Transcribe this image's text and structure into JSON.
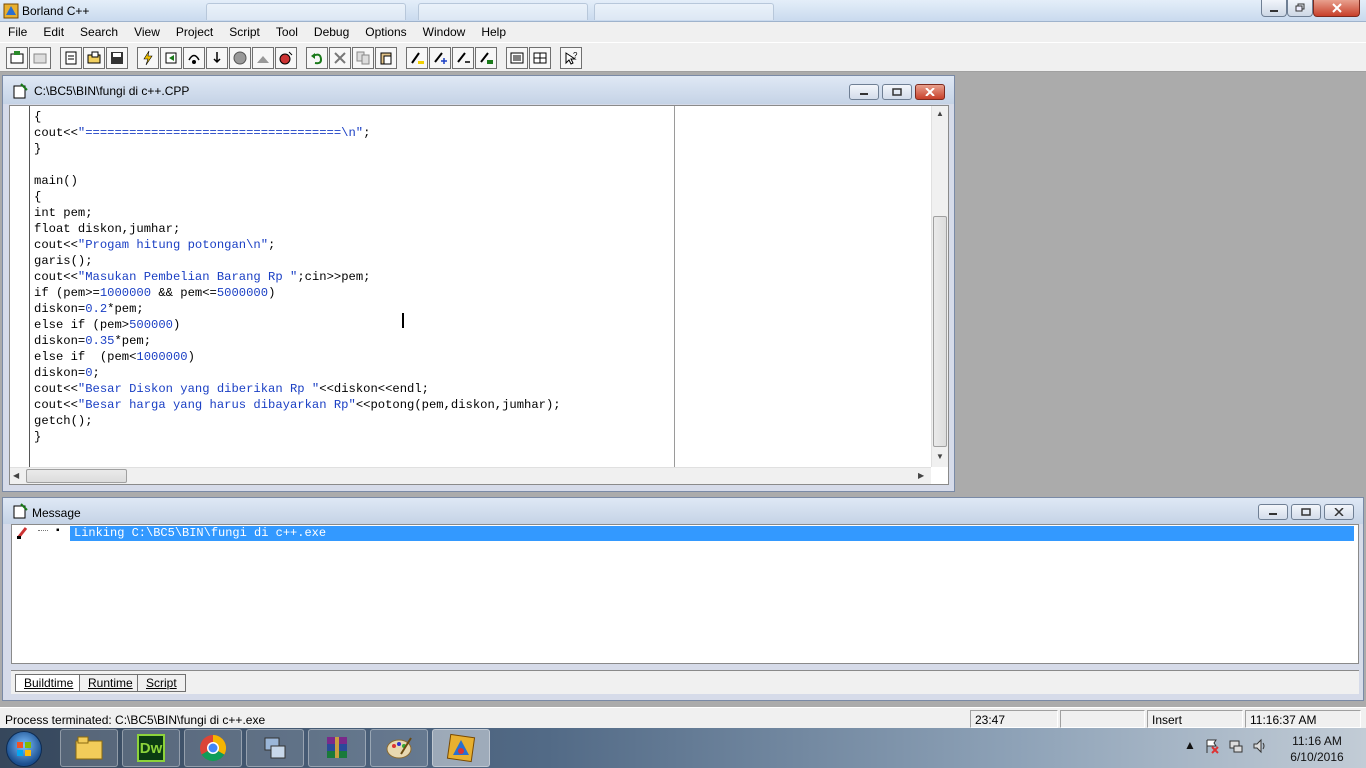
{
  "app": {
    "title": "Borland C++"
  },
  "menu": [
    "File",
    "Edit",
    "Search",
    "View",
    "Project",
    "Script",
    "Tool",
    "Debug",
    "Options",
    "Window",
    "Help"
  ],
  "toolbar": {
    "icons": [
      "open-project-icon",
      "close-project-icon",
      "new-file-icon",
      "open-file-icon",
      "save-file-icon",
      "make-icon",
      "build-icon",
      "step-over-icon",
      "trace-into-icon",
      "stop-icon",
      "pause-icon",
      "run-icon",
      "undo-icon",
      "cut-icon",
      "copy-icon",
      "paste-icon",
      "find-icon",
      "replace-icon",
      "search-again-icon",
      "browse-icon",
      "list-icon",
      "window-tile-icon",
      "help-icon"
    ]
  },
  "editor": {
    "title": "C:\\BC5\\BIN\\fungi di c++.CPP",
    "code": [
      [
        {
          "t": "{"
        }
      ],
      [
        {
          "t": "cout<<"
        },
        {
          "t": "\"===================================\\n\"",
          "s": 1
        },
        {
          "t": ";"
        }
      ],
      [
        {
          "t": "}"
        }
      ],
      [
        {
          "t": ""
        }
      ],
      [
        {
          "t": "main()"
        }
      ],
      [
        {
          "t": "{"
        }
      ],
      [
        {
          "t": "int pem;"
        }
      ],
      [
        {
          "t": "float diskon,jumhar;"
        }
      ],
      [
        {
          "t": "cout<<"
        },
        {
          "t": "\"Progam hitung potongan\\n\"",
          "s": 1
        },
        {
          "t": ";"
        }
      ],
      [
        {
          "t": "garis();"
        }
      ],
      [
        {
          "t": "cout<<"
        },
        {
          "t": "\"Masukan Pembelian Barang Rp \"",
          "s": 1
        },
        {
          "t": ";cin>>pem;"
        }
      ],
      [
        {
          "t": "if (pem>="
        },
        {
          "t": "1000000",
          "s": 1
        },
        {
          "t": " && pem<="
        },
        {
          "t": "5000000",
          "s": 1
        },
        {
          "t": ")"
        }
      ],
      [
        {
          "t": "diskon="
        },
        {
          "t": "0.2",
          "s": 1
        },
        {
          "t": "*pem;"
        }
      ],
      [
        {
          "t": "else if (pem>"
        },
        {
          "t": "500000",
          "s": 1
        },
        {
          "t": ")"
        }
      ],
      [
        {
          "t": "diskon="
        },
        {
          "t": "0.35",
          "s": 1
        },
        {
          "t": "*pem;"
        }
      ],
      [
        {
          "t": "else if  (pem<"
        },
        {
          "t": "1000000",
          "s": 1
        },
        {
          "t": ")"
        }
      ],
      [
        {
          "t": "diskon="
        },
        {
          "t": "0",
          "s": 1
        },
        {
          "t": ";"
        }
      ],
      [
        {
          "t": "cout<<"
        },
        {
          "t": "\"Besar Diskon yang diberikan Rp \"",
          "s": 1
        },
        {
          "t": "<<diskon<<endl;"
        }
      ],
      [
        {
          "t": "cout<<"
        },
        {
          "t": "\"Besar harga yang harus dibayarkan Rp\"",
          "s": 1
        },
        {
          "t": "<<potong(pem,diskon,jumhar);"
        }
      ],
      [
        {
          "t": "getch();"
        }
      ],
      [
        {
          "t": "}"
        }
      ]
    ],
    "string_color": "#1a3fc4"
  },
  "message": {
    "title": "Message",
    "rows": [
      {
        "text": "Linking C:\\BC5\\BIN\\fungi di c++.exe",
        "icon": "linker-icon"
      }
    ],
    "tabs": [
      "Buildtime",
      "Runtime",
      "Script"
    ]
  },
  "status": {
    "text": "Process terminated: C:\\BC5\\BIN\\fungi di c++.exe",
    "position": "23:47",
    "extra": "",
    "mode": "Insert",
    "time": "11:16:37 AM"
  },
  "taskbar": {
    "apps": [
      "explorer-icon",
      "dreamweaver-icon",
      "chrome-icon",
      "network-icon",
      "winrar-icon",
      "paint-icon",
      "borland-icon"
    ],
    "dw_label": "Dw",
    "clock_time": "11:16 AM",
    "clock_date": "6/10/2016"
  },
  "colors": {
    "selection": "#3399ff",
    "desktop": "#ababab"
  }
}
